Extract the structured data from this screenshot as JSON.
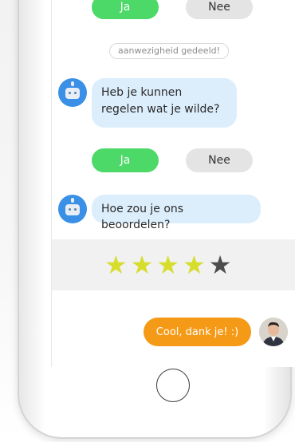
{
  "chat": {
    "choice_1": {
      "yes": "Ja",
      "no": "Nee"
    },
    "notice": "aanwezigheid gedeeld!",
    "bot_message_1": "Heb je kunnen regelen wat je wilde?",
    "choice_2": {
      "yes": "Ja",
      "no": "Nee"
    },
    "bot_message_2": "Hoe zou je ons beoordelen?",
    "rating": {
      "value": 4,
      "max": 5,
      "star_glyph": "★"
    },
    "user_message": "Cool, dank je! :)"
  },
  "colors": {
    "yes_button": "#4cd968",
    "no_button": "#e4e4e4",
    "bot_bubble": "#dceefc",
    "bot_avatar": "#3a8fe6",
    "user_bubble": "#f59a16",
    "star_on": "#d6dd2d",
    "star_off": "#4d4d4d"
  },
  "icons": {
    "bot_avatar": "robot-avatar-icon",
    "user_avatar": "user-photo-avatar",
    "home_button": "home-button-circle"
  }
}
